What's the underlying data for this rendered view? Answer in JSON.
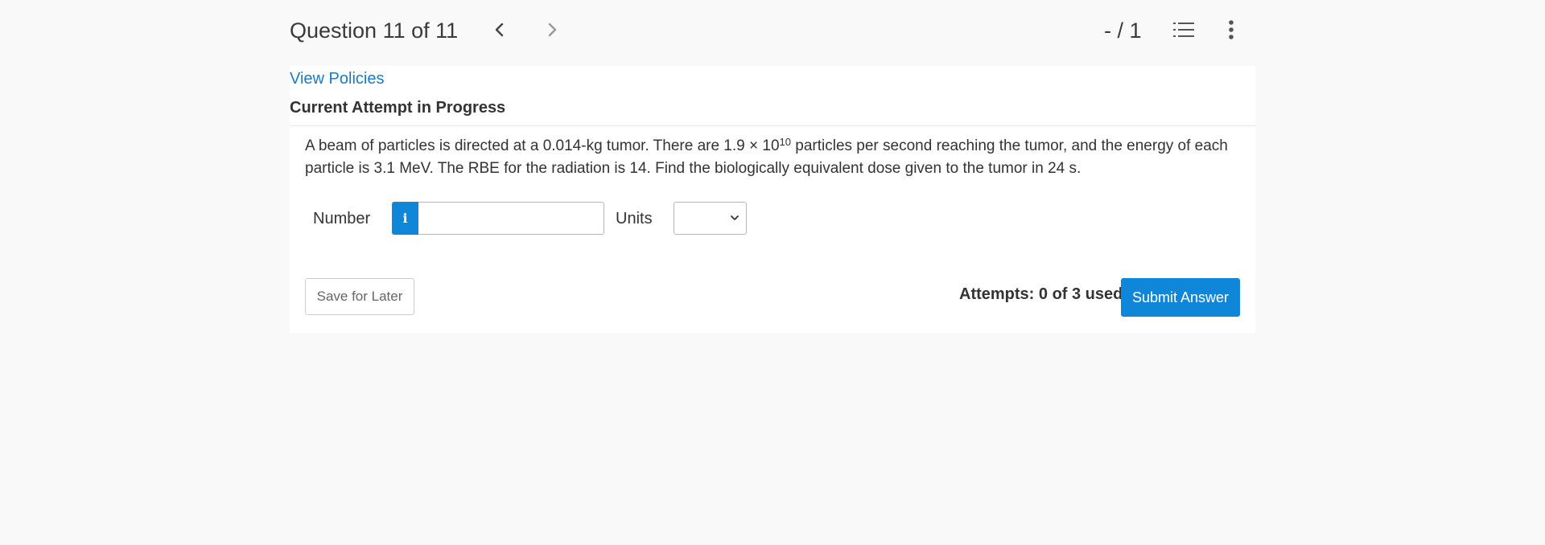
{
  "header": {
    "question_label": "Question 11 of 11",
    "score": "- / 1",
    "icons": [
      "chevron-left-icon",
      "chevron-right-icon",
      "list-icon",
      "more-vertical-icon"
    ]
  },
  "card": {
    "view_policies": "View Policies",
    "attempt_status": "Current Attempt in Progress",
    "question": {
      "part1": "A beam of particles is directed at a 0.014-kg tumor. There are 1.9 × 10",
      "exponent": "10",
      "part2": " particles per second reaching the tumor, and the energy of each particle is 3.1 MeV. The RBE for the radiation is 14. Find the biologically equivalent dose given to the tumor in 24 s."
    },
    "answer": {
      "number_label": "Number",
      "info_icon_glyph": "i",
      "number_value": "",
      "units_label": "Units",
      "units_selected": ""
    },
    "footer": {
      "save_label": "Save for Later",
      "attempts": "Attempts: 0 of 3 used",
      "submit_label": "Submit Answer"
    }
  },
  "colors": {
    "accent": "#0f86d8",
    "link": "#1a7ac8",
    "background": "#f9f9f9",
    "card": "#ffffff"
  }
}
